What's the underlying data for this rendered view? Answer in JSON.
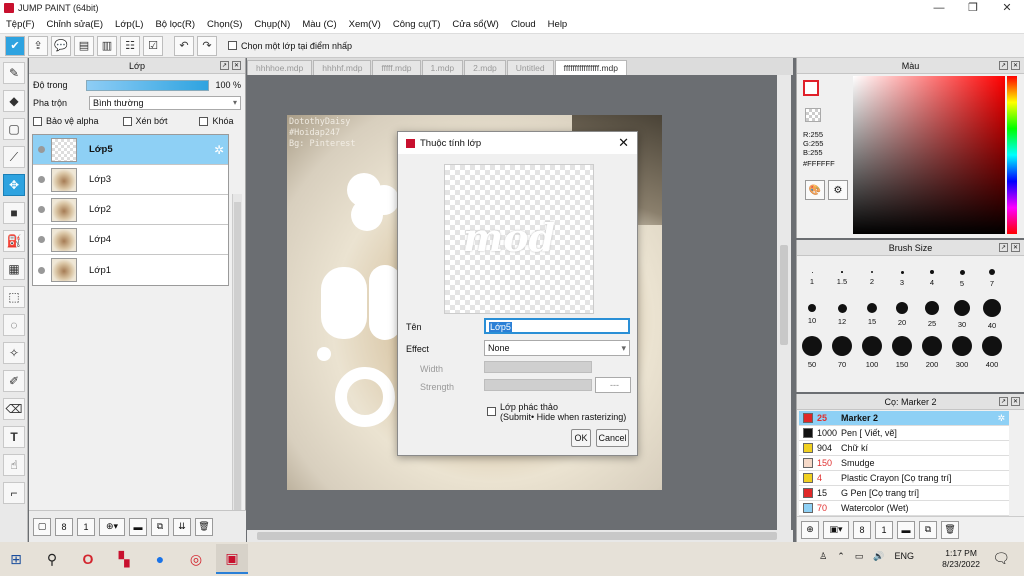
{
  "window": {
    "title": "JUMP PAINT (64bit)",
    "buttons": [
      "—",
      "❐",
      "✕"
    ]
  },
  "menu": [
    "Tệp(F)",
    "Chỉnh sửa(E)",
    "Lớp(L)",
    "Bộ lọc(R)",
    "Chọn(S)",
    "Chụp(N)",
    "Màu (C)",
    "Xem(V)",
    "Công cụ(T)",
    "Cửa sổ(W)",
    "Cloud",
    "Help"
  ],
  "toolbar": {
    "option_label": "Chọn một lớp tại điểm nhấp"
  },
  "layer_panel": {
    "title": "Lớp",
    "opacity_label": "Độ trong",
    "opacity_value": "100 %",
    "opacity_fraction": 1.0,
    "blend_label": "Pha trộn",
    "blend_value": "Bình thường",
    "protect_alpha": "Bảo vệ alpha",
    "clipping": "Xén bớt",
    "lock": "Khóa",
    "layers": [
      {
        "name": "Lớp5",
        "selected": true,
        "thumb": "transparent"
      },
      {
        "name": "Lớp3",
        "selected": false,
        "thumb": "photo"
      },
      {
        "name": "Lớp2",
        "selected": false,
        "thumb": "photo"
      },
      {
        "name": "Lớp4",
        "selected": false,
        "thumb": "photo"
      },
      {
        "name": "Lớp1",
        "selected": false,
        "thumb": "photo"
      }
    ]
  },
  "doc_tabs": [
    {
      "label": "hhhhoe.mdp",
      "active": false
    },
    {
      "label": "hhhhf.mdp",
      "active": false
    },
    {
      "label": "fffff.mdp",
      "active": false
    },
    {
      "label": "1.mdp",
      "active": false
    },
    {
      "label": "2.mdp",
      "active": false
    },
    {
      "label": "Untitled",
      "active": false
    },
    {
      "label": "ffffffffffffffff.mdp",
      "active": true
    }
  ],
  "artwork": {
    "watermark": [
      "DotothyDaisy",
      "#Hoidap247",
      "Bg: Pinterest"
    ]
  },
  "dialog": {
    "title": "Thuộc tính lớp",
    "preview_text": "mod",
    "name_label": "Tên",
    "name_value": "Lớp5",
    "effect_label": "Effect",
    "effect_value": "None",
    "width_label": "Width",
    "strength_label": "Strength",
    "strength_value": "---",
    "draft_label": "Lớp phác thảo",
    "draft_sub": "(Submit• Hide when rasterizing)",
    "ok": "OK",
    "cancel": "Cancel"
  },
  "color_panel": {
    "title": "Màu",
    "r": "R:255",
    "g": "G:255",
    "b": "B:255",
    "hex": "#FFFFFF",
    "main_color": "#FFFFFF",
    "accent": "#E0202A"
  },
  "brush_size_panel": {
    "title": "Brush Size",
    "sizes": [
      "1",
      "1.5",
      "2",
      "3",
      "4",
      "5",
      "7",
      "10",
      "12",
      "15",
      "20",
      "25",
      "30",
      "40",
      "50",
      "70",
      "100",
      "150",
      "200",
      "300",
      "400"
    ]
  },
  "brush_list_panel": {
    "title": "Cọ: Marker 2",
    "items": [
      {
        "num": "25",
        "name": "Marker 2",
        "color": "#E02828",
        "selected": true
      },
      {
        "num": "1000",
        "name": "Pen [ Viết, vẽ]",
        "color": "#111111",
        "selected": false
      },
      {
        "num": "904",
        "name": "Chữ kí",
        "color": "#F0D020",
        "selected": false
      },
      {
        "num": "150",
        "name": "Smudge",
        "color": "#F6D9C8",
        "selected": false
      },
      {
        "num": "4",
        "name": "Plastic Crayon [Cọ trang trí]",
        "color": "#F0D020",
        "selected": false
      },
      {
        "num": "15",
        "name": "G Pen [Cọ trang trí]",
        "color": "#E02828",
        "selected": false
      },
      {
        "num": "70",
        "name": "Watercolor (Wet)",
        "color": "#8ED0F5",
        "selected": false
      }
    ]
  },
  "taskbar": {
    "time": "1:17 PM",
    "date": "8/23/2022",
    "lang": "ENG"
  }
}
